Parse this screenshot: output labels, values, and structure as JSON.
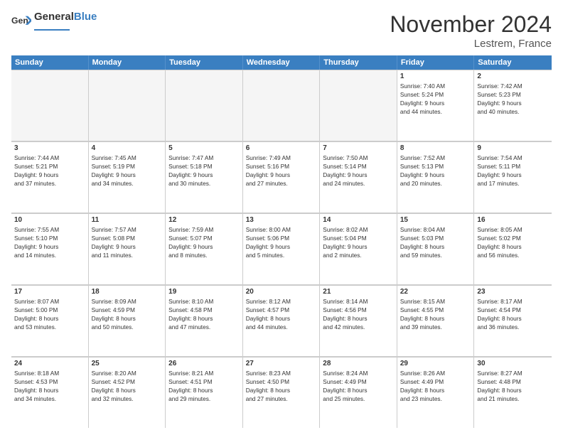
{
  "header": {
    "logo_general": "General",
    "logo_blue": "Blue",
    "month_title": "November 2024",
    "location": "Lestrem, France"
  },
  "days_of_week": [
    "Sunday",
    "Monday",
    "Tuesday",
    "Wednesday",
    "Thursday",
    "Friday",
    "Saturday"
  ],
  "weeks": [
    [
      {
        "day": "",
        "info": ""
      },
      {
        "day": "",
        "info": ""
      },
      {
        "day": "",
        "info": ""
      },
      {
        "day": "",
        "info": ""
      },
      {
        "day": "",
        "info": ""
      },
      {
        "day": "1",
        "info": "Sunrise: 7:40 AM\nSunset: 5:24 PM\nDaylight: 9 hours\nand 44 minutes."
      },
      {
        "day": "2",
        "info": "Sunrise: 7:42 AM\nSunset: 5:23 PM\nDaylight: 9 hours\nand 40 minutes."
      }
    ],
    [
      {
        "day": "3",
        "info": "Sunrise: 7:44 AM\nSunset: 5:21 PM\nDaylight: 9 hours\nand 37 minutes."
      },
      {
        "day": "4",
        "info": "Sunrise: 7:45 AM\nSunset: 5:19 PM\nDaylight: 9 hours\nand 34 minutes."
      },
      {
        "day": "5",
        "info": "Sunrise: 7:47 AM\nSunset: 5:18 PM\nDaylight: 9 hours\nand 30 minutes."
      },
      {
        "day": "6",
        "info": "Sunrise: 7:49 AM\nSunset: 5:16 PM\nDaylight: 9 hours\nand 27 minutes."
      },
      {
        "day": "7",
        "info": "Sunrise: 7:50 AM\nSunset: 5:14 PM\nDaylight: 9 hours\nand 24 minutes."
      },
      {
        "day": "8",
        "info": "Sunrise: 7:52 AM\nSunset: 5:13 PM\nDaylight: 9 hours\nand 20 minutes."
      },
      {
        "day": "9",
        "info": "Sunrise: 7:54 AM\nSunset: 5:11 PM\nDaylight: 9 hours\nand 17 minutes."
      }
    ],
    [
      {
        "day": "10",
        "info": "Sunrise: 7:55 AM\nSunset: 5:10 PM\nDaylight: 9 hours\nand 14 minutes."
      },
      {
        "day": "11",
        "info": "Sunrise: 7:57 AM\nSunset: 5:08 PM\nDaylight: 9 hours\nand 11 minutes."
      },
      {
        "day": "12",
        "info": "Sunrise: 7:59 AM\nSunset: 5:07 PM\nDaylight: 9 hours\nand 8 minutes."
      },
      {
        "day": "13",
        "info": "Sunrise: 8:00 AM\nSunset: 5:06 PM\nDaylight: 9 hours\nand 5 minutes."
      },
      {
        "day": "14",
        "info": "Sunrise: 8:02 AM\nSunset: 5:04 PM\nDaylight: 9 hours\nand 2 minutes."
      },
      {
        "day": "15",
        "info": "Sunrise: 8:04 AM\nSunset: 5:03 PM\nDaylight: 8 hours\nand 59 minutes."
      },
      {
        "day": "16",
        "info": "Sunrise: 8:05 AM\nSunset: 5:02 PM\nDaylight: 8 hours\nand 56 minutes."
      }
    ],
    [
      {
        "day": "17",
        "info": "Sunrise: 8:07 AM\nSunset: 5:00 PM\nDaylight: 8 hours\nand 53 minutes."
      },
      {
        "day": "18",
        "info": "Sunrise: 8:09 AM\nSunset: 4:59 PM\nDaylight: 8 hours\nand 50 minutes."
      },
      {
        "day": "19",
        "info": "Sunrise: 8:10 AM\nSunset: 4:58 PM\nDaylight: 8 hours\nand 47 minutes."
      },
      {
        "day": "20",
        "info": "Sunrise: 8:12 AM\nSunset: 4:57 PM\nDaylight: 8 hours\nand 44 minutes."
      },
      {
        "day": "21",
        "info": "Sunrise: 8:14 AM\nSunset: 4:56 PM\nDaylight: 8 hours\nand 42 minutes."
      },
      {
        "day": "22",
        "info": "Sunrise: 8:15 AM\nSunset: 4:55 PM\nDaylight: 8 hours\nand 39 minutes."
      },
      {
        "day": "23",
        "info": "Sunrise: 8:17 AM\nSunset: 4:54 PM\nDaylight: 8 hours\nand 36 minutes."
      }
    ],
    [
      {
        "day": "24",
        "info": "Sunrise: 8:18 AM\nSunset: 4:53 PM\nDaylight: 8 hours\nand 34 minutes."
      },
      {
        "day": "25",
        "info": "Sunrise: 8:20 AM\nSunset: 4:52 PM\nDaylight: 8 hours\nand 32 minutes."
      },
      {
        "day": "26",
        "info": "Sunrise: 8:21 AM\nSunset: 4:51 PM\nDaylight: 8 hours\nand 29 minutes."
      },
      {
        "day": "27",
        "info": "Sunrise: 8:23 AM\nSunset: 4:50 PM\nDaylight: 8 hours\nand 27 minutes."
      },
      {
        "day": "28",
        "info": "Sunrise: 8:24 AM\nSunset: 4:49 PM\nDaylight: 8 hours\nand 25 minutes."
      },
      {
        "day": "29",
        "info": "Sunrise: 8:26 AM\nSunset: 4:49 PM\nDaylight: 8 hours\nand 23 minutes."
      },
      {
        "day": "30",
        "info": "Sunrise: 8:27 AM\nSunset: 4:48 PM\nDaylight: 8 hours\nand 21 minutes."
      }
    ]
  ]
}
